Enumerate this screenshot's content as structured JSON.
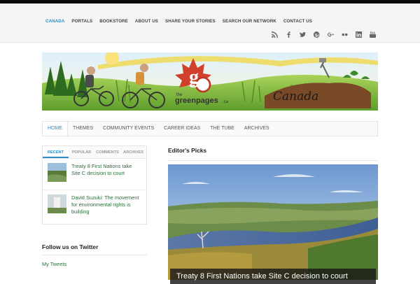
{
  "top_nav": [
    "Canada",
    "Portals",
    "Bookstore",
    "About Us",
    "Share your Stories",
    "Search our Network",
    "Contact Us"
  ],
  "social_icons": [
    "rss-icon",
    "facebook-icon",
    "twitter-icon",
    "pinterest-icon",
    "google-plus-icon",
    "flickr-icon",
    "linkedin-icon",
    "youtube-icon"
  ],
  "banner": {
    "logo_the": "the",
    "logo_main": "greenpages",
    "logo_suffix": ".ca",
    "region": "Canada"
  },
  "main_nav": [
    "Home",
    "Themes",
    "Community Events",
    "Career Ideas",
    "The Tube",
    "Archives"
  ],
  "sidebar": {
    "tabs": [
      "Recent",
      "Popular",
      "Comments",
      "Archives"
    ],
    "items": [
      {
        "title": "Treaty 8 First Nations take Site C decision to court"
      },
      {
        "title": "David Suzuki: The movement for environmental rights is building"
      }
    ],
    "follow_title": "Follow us on Twitter",
    "my_tweets": "My Tweets"
  },
  "main": {
    "section_title": "Editor's Picks",
    "feature_caption": "Treaty 8 First Nations take Site C decision to court"
  },
  "colors": {
    "accent": "#2a8fc4",
    "link": "#2c6f3e",
    "topbar": "#0b0b0b"
  }
}
